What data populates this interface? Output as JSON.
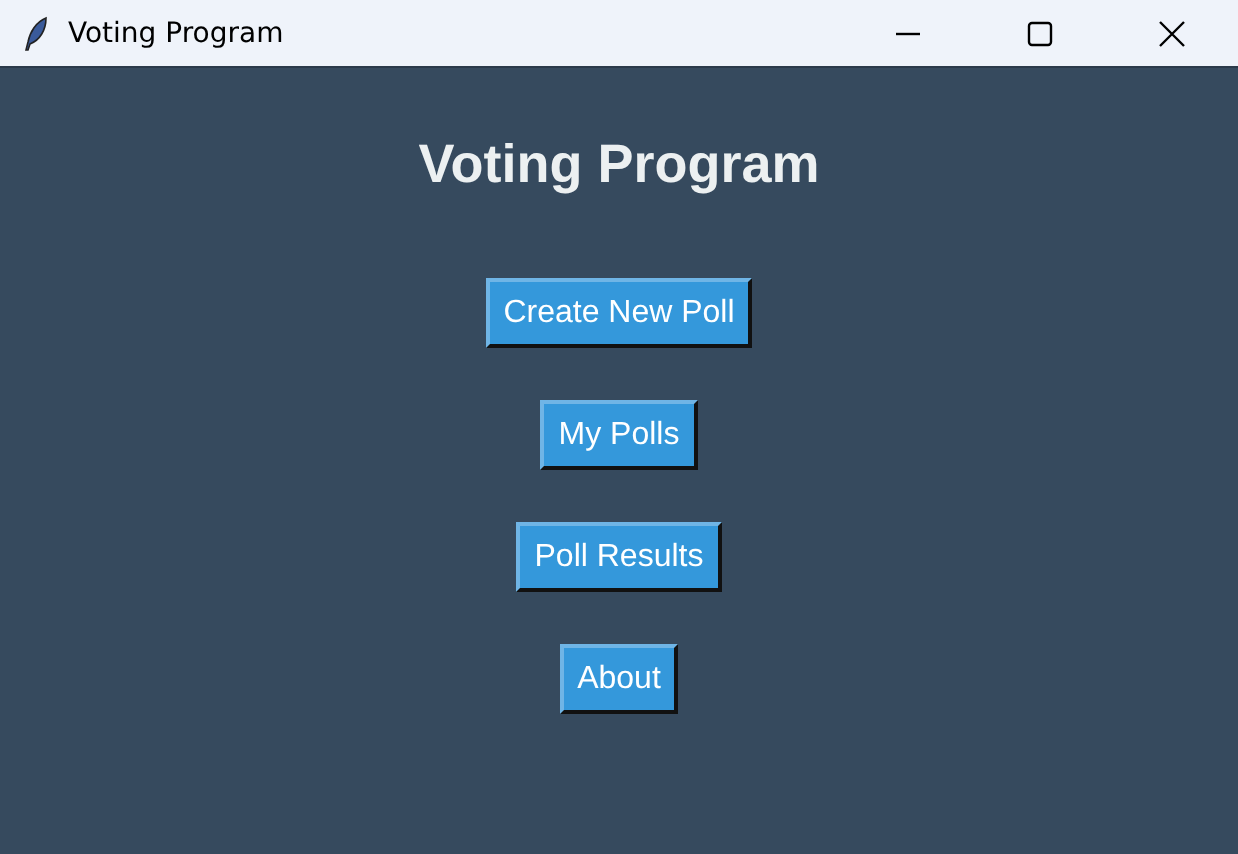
{
  "window": {
    "title": "Voting Program"
  },
  "heading": "Voting Program",
  "buttons": [
    "Create New Poll",
    "My Polls",
    "Poll Results",
    "About"
  ]
}
